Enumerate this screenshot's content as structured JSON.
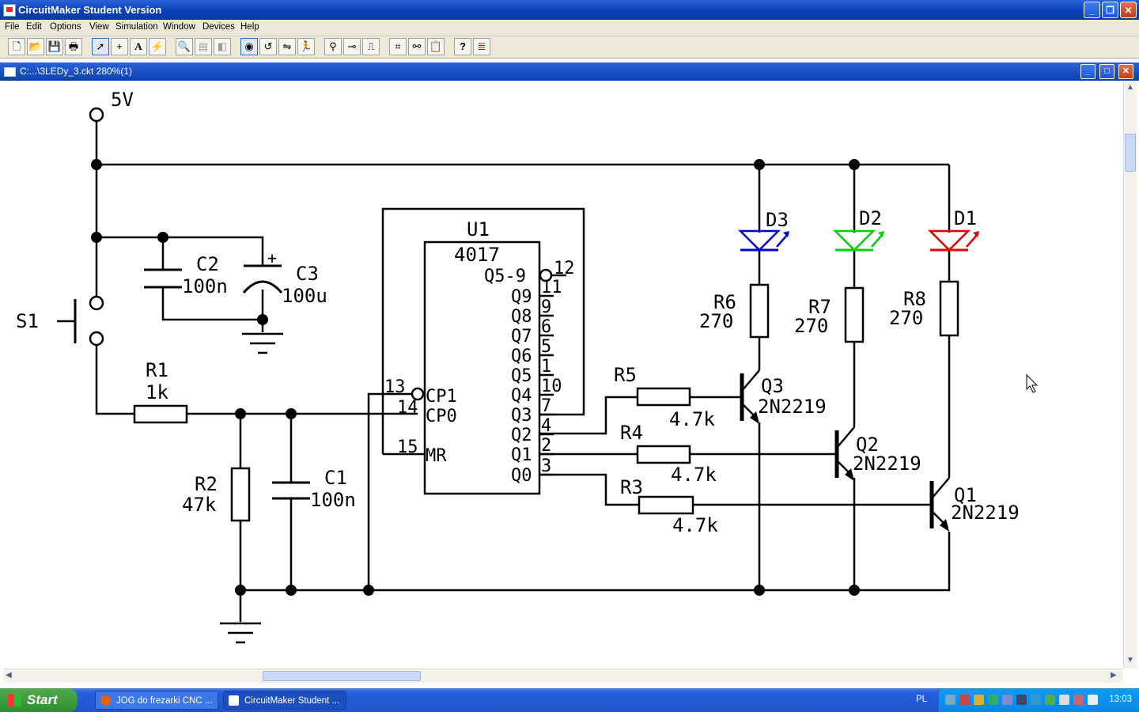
{
  "window": {
    "title": "CircuitMaker Student Version"
  },
  "menu": [
    "File",
    "Edit",
    "Options",
    "View",
    "Simulation",
    "Window",
    "Devices",
    "Help"
  ],
  "toolbar_icons": [
    "new-icon",
    "open-icon",
    "save-icon",
    "print-icon",
    "arrow-tool-icon",
    "wire-tool-icon",
    "text-tool-icon",
    "probe-tool-icon",
    "zoom-icon",
    "cut-icon",
    "copy-icon",
    "digital-icon",
    "rotate-icon",
    "mirror-icon",
    "run-icon",
    "search-icon",
    "connect-icon",
    "waveform-icon",
    "netlist-icon",
    "binoculars-icon",
    "clipboard-icon",
    "help-icon",
    "colors-icon"
  ],
  "document": {
    "title": "C:...\\3LEDy_3.ckt 280%(1)"
  },
  "schematic": {
    "supply": "5V",
    "switch": "S1",
    "r1": {
      "name": "R1",
      "value": "1k"
    },
    "r2": {
      "name": "R2",
      "value": "47k"
    },
    "r3": {
      "name": "R3",
      "value": "4.7k"
    },
    "r4": {
      "name": "R4",
      "value": "4.7k"
    },
    "r5": {
      "name": "R5",
      "value": "4.7k"
    },
    "r6": {
      "name": "R6",
      "value": "270"
    },
    "r7": {
      "name": "R7",
      "value": "270"
    },
    "r8": {
      "name": "R8",
      "value": "270"
    },
    "c1": {
      "name": "C1",
      "value": "100n"
    },
    "c2": {
      "name": "C2",
      "value": "100n"
    },
    "c3": {
      "name": "C3",
      "value": "100u",
      "polarity": "+"
    },
    "u1": {
      "name": "U1",
      "part": "4017",
      "pins_left": [
        {
          "num": "13",
          "label": "CP1"
        },
        {
          "num": "14",
          "label": "CP0"
        },
        {
          "num": "15",
          "label": "MR"
        }
      ],
      "pins_right": [
        {
          "num": "12",
          "label": "Q5-9"
        },
        {
          "num": "11",
          "label": "Q9"
        },
        {
          "num": "9",
          "label": "Q8"
        },
        {
          "num": "6",
          "label": "Q7"
        },
        {
          "num": "5",
          "label": "Q6"
        },
        {
          "num": "1",
          "label": "Q5"
        },
        {
          "num": "10",
          "label": "Q4"
        },
        {
          "num": "7",
          "label": "Q3"
        },
        {
          "num": "4",
          "label": "Q2"
        },
        {
          "num": "2",
          "label": "Q1"
        },
        {
          "num": "3",
          "label": "Q0"
        }
      ]
    },
    "d1": {
      "name": "D1",
      "color": "#e00000"
    },
    "d2": {
      "name": "D2",
      "color": "#00d000"
    },
    "d3": {
      "name": "D3",
      "color": "#0000d0"
    },
    "q1": {
      "name": "Q1",
      "part": "2N2219"
    },
    "q2": {
      "name": "Q2",
      "part": "2N2219"
    },
    "q3": {
      "name": "Q3",
      "part": "2N2219"
    }
  },
  "taskbar": {
    "start": "Start",
    "tasks": [
      {
        "label": "JOG do frezarki CNC ..."
      },
      {
        "label": "CircuitMaker Student ..."
      }
    ],
    "lang": "PL",
    "clock": "13:03"
  }
}
